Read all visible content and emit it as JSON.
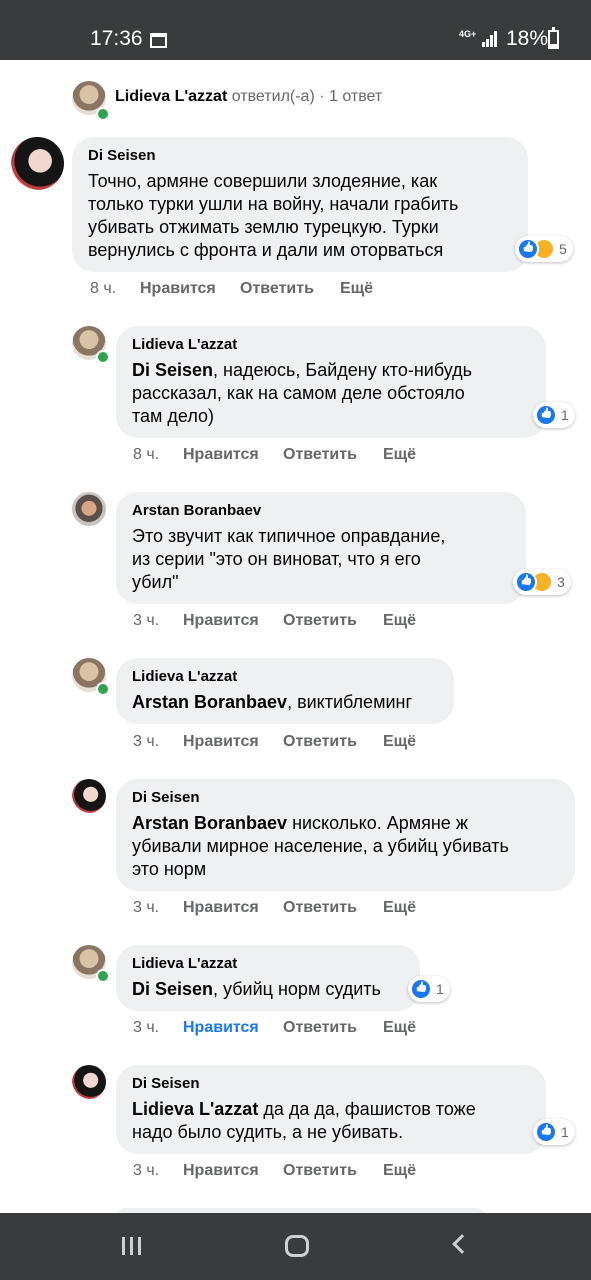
{
  "statusbar": {
    "time": "17:36",
    "network": "4G+",
    "battery": "18%"
  },
  "thread_header": {
    "author": "Lidieva L'azzat",
    "action": "ответил(-а)",
    "separator": "·",
    "replies": "1 ответ"
  },
  "actions": {
    "like": "Нравится",
    "reply": "Ответить",
    "more": "Ещё"
  },
  "comments": [
    {
      "author": "Di Seisen",
      "mention": "",
      "text": "Точно, армяне совершили злодеяние, как\nтолько турки ушли на войну, начали грабить\nубивать отжимать землю турецкую. Турки\nвернулись с фронта и дали им оторваться",
      "time": "8 ч.",
      "reactions": "5"
    },
    {
      "author": "Lidieva L'azzat",
      "mention": "Di Seisen",
      "text": ", надеюсь, Байдену кто-нибудь\nрассказал, как на самом деле обстояло\nтам дело)",
      "time": "8 ч.",
      "reactions": "1"
    },
    {
      "author": "Arstan Boranbaev",
      "mention": "",
      "text": "Это звучит как типичное оправдание,\nиз серии \"это он виноват, что я его\nубил\"",
      "time": "3 ч.",
      "reactions": "3"
    },
    {
      "author": "Lidieva L'azzat",
      "mention": "Arstan Boranbaev",
      "text": ", виктиблеминг",
      "time": "3 ч.",
      "reactions": ""
    },
    {
      "author": "Di Seisen",
      "mention": "Arstan Boranbaev",
      "text": " нисколько. Армяне ж\nубивали мирное население, а убийц убивать\nэто норм",
      "time": "3 ч.",
      "reactions": ""
    },
    {
      "author": "Lidieva L'azzat",
      "mention": "Di Seisen",
      "text": ", убийц норм судить",
      "time": "3 ч.",
      "reactions": "1"
    },
    {
      "author": "Di Seisen",
      "mention": "Lidieva L'azzat",
      "text": " да да да, фашистов тоже\nнадо было судить, а не убивать.",
      "time": "3 ч.",
      "reactions": "1"
    }
  ],
  "colors": {
    "liked": "#1877f2",
    "bubble": "#eef0f2",
    "online": "#31a24c",
    "bars": "#3a3b3c"
  }
}
